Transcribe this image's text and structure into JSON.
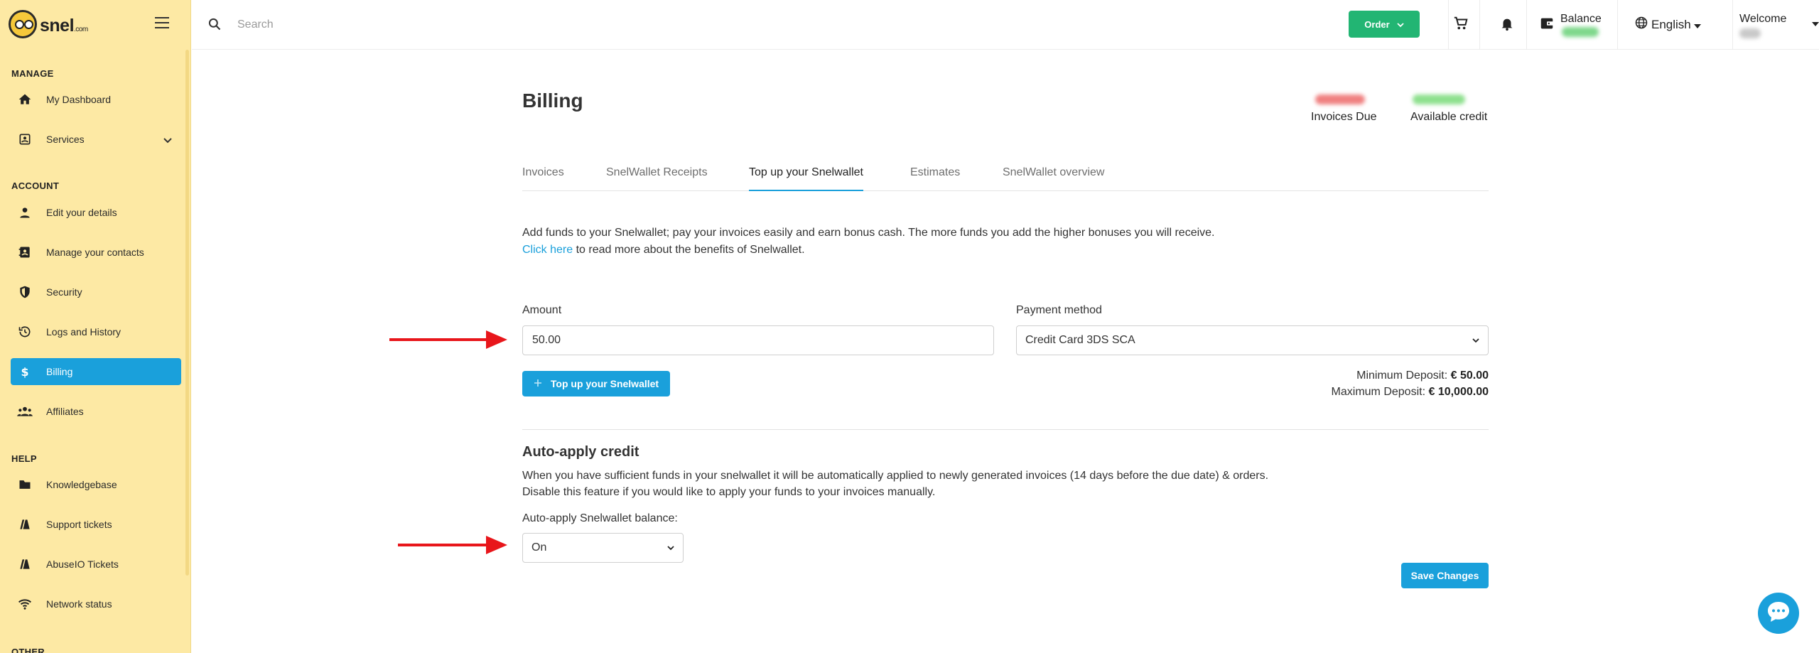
{
  "sidebar": {
    "brand": "snel",
    "brand_suffix": ".com",
    "sections": [
      {
        "title": "MANAGE"
      },
      {
        "title": "ACCOUNT"
      },
      {
        "title": "HELP"
      },
      {
        "title": "OTHER"
      }
    ],
    "items": [
      {
        "label": "My Dashboard",
        "icon": "home-icon"
      },
      {
        "label": "Services",
        "icon": "services-icon"
      },
      {
        "label": "Edit your details",
        "icon": "user-icon"
      },
      {
        "label": "Manage your contacts",
        "icon": "contacts-icon"
      },
      {
        "label": "Security",
        "icon": "shield-icon"
      },
      {
        "label": "Logs and History",
        "icon": "history-icon"
      },
      {
        "label": "Billing",
        "icon": "dollar-icon"
      },
      {
        "label": "Affiliates",
        "icon": "affiliates-icon"
      },
      {
        "label": "Knowledgebase",
        "icon": "folder-icon"
      },
      {
        "label": "Support tickets",
        "icon": "ticket-icon"
      },
      {
        "label": "AbuseIO Tickets",
        "icon": "ticket-icon"
      },
      {
        "label": "Network status",
        "icon": "wifi-icon"
      }
    ]
  },
  "topbar": {
    "search_placeholder": "Search",
    "order_label": "Order",
    "balance_label": "Balance",
    "language": "English",
    "welcome": "Welcome"
  },
  "page": {
    "title": "Billing",
    "stats": [
      {
        "label": "Invoices Due",
        "color": "#e04a4a"
      },
      {
        "label": "Available credit",
        "color": "#2fbf5f"
      }
    ],
    "tabs": [
      {
        "label": "Invoices"
      },
      {
        "label": "SnelWallet Receipts"
      },
      {
        "label": "Top up your Snelwallet"
      },
      {
        "label": "Estimates"
      },
      {
        "label": "SnelWallet overview"
      }
    ],
    "desc_line1": "Add funds to your Snelwallet; pay your invoices easily and earn bonus cash. The more funds you add the higher bonuses you will receive.",
    "desc_link": "Click here",
    "desc_line2": " to read more about the benefits of Snelwallet.",
    "amount_label": "Amount",
    "amount_value": "50.00",
    "payment_label": "Payment method",
    "payment_value": "Credit Card 3DS SCA",
    "topup_label": "Top up your Snelwallet",
    "min_label": "Minimum Deposit: ",
    "min_value": "€ 50.00",
    "max_label": "Maximum Deposit: ",
    "max_value": "€ 10,000.00",
    "auto_title": "Auto-apply credit",
    "auto_line1": "When you have sufficient funds in your snelwallet it will be automatically applied to newly generated invoices (14 days before the due date) & orders.",
    "auto_line2": "Disable this feature if you would like to apply your funds to your invoices manually.",
    "auto_label": "Auto-apply Snelwallet balance:",
    "auto_value": "On",
    "save_label": "Save Changes"
  },
  "colors": {
    "accent": "#1aa0db",
    "order": "#22b573",
    "sidebar": "#fde9a4",
    "arrow": "#e8161b"
  }
}
